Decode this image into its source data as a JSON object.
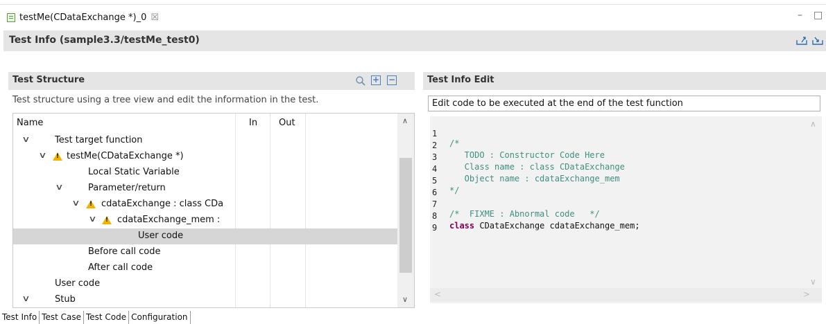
{
  "editor_tab": {
    "label": "testMe(CDataExchange *)_0",
    "close_glyph": "☒"
  },
  "window_buttons": {
    "minimize": "–",
    "maximize": "□"
  },
  "header": {
    "title": "Test Info (sample3.3/testMe_test0)"
  },
  "test_structure": {
    "title": "Test Structure",
    "description": "Test structure using a tree view and edit the information in the test.",
    "columns": [
      "Name",
      "In",
      "Out"
    ],
    "rows": [
      {
        "label": "Test target function",
        "chevron": "∨"
      },
      {
        "label": "testMe(CDataExchange *)",
        "chevron": "∨"
      },
      {
        "label": "Local Static Variable"
      },
      {
        "label": "Parameter/return",
        "chevron": "∨"
      },
      {
        "label": "cdataExchange  :  class CDa",
        "chevron": "∨"
      },
      {
        "label": "cdataExchange_mem  :",
        "chevron": "∨"
      },
      {
        "label": "User code",
        "selected": true
      },
      {
        "label": "Before call code"
      },
      {
        "label": "After call code"
      },
      {
        "label": "User code"
      },
      {
        "label": "Stub",
        "chevron": "∨"
      }
    ]
  },
  "test_info_edit": {
    "title": "Test Info Edit",
    "field_value": "Edit code to be executed at the end of the test function",
    "code_lines": [
      {
        "n": "1",
        "text": "/*"
      },
      {
        "n": "2",
        "text": "   TODO : Constructor Code Here"
      },
      {
        "n": "3",
        "text": "   Class name : class CDataExchange"
      },
      {
        "n": "4",
        "text": "   Object name : cdataExchange_mem"
      },
      {
        "n": "5",
        "text": "*/"
      },
      {
        "n": "6",
        "text": ""
      },
      {
        "n": "7",
        "text": "/*  FIXME : Abnormal code   */"
      },
      {
        "n": "8",
        "kw": "class",
        "text": " CDataExchange cdataExchange_mem;"
      },
      {
        "n": "9",
        "text": ""
      }
    ]
  },
  "bottom_tabs": [
    "Test Info",
    "Test Case",
    "Test Code",
    "Configuration"
  ]
}
